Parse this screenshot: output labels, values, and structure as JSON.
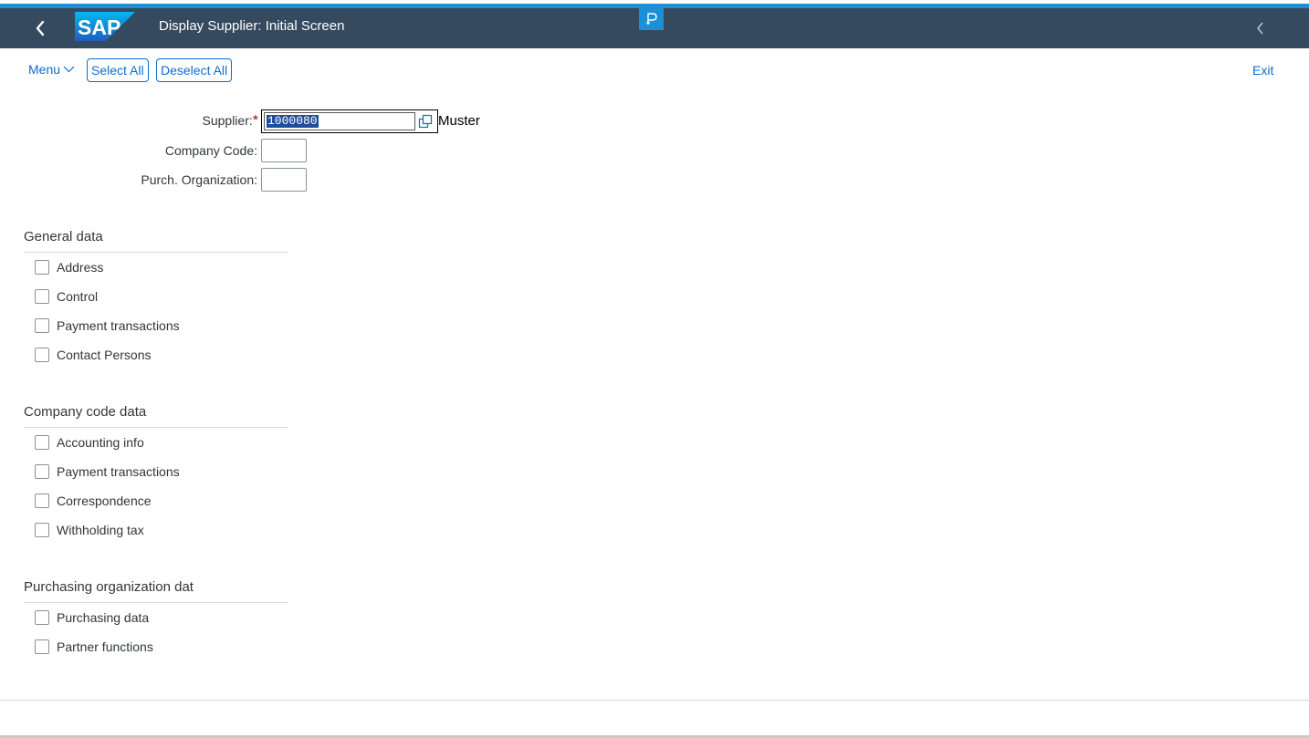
{
  "shell": {
    "title": "Display Supplier:  Initial Screen",
    "logo_text": "SAP",
    "brand_color": "#354a5f",
    "accent_color": "#1b90d8",
    "icons": [
      "back-icon",
      "sap-logo",
      "app-icon",
      "collapse-icon"
    ]
  },
  "toolbar": {
    "menu_label": "Menu",
    "select_all_label": "Select All",
    "deselect_all_label": "Deselect All",
    "exit_label": "Exit"
  },
  "fields": {
    "supplier_label": "Supplier:",
    "required_marker": "*",
    "supplier_value": "1000080",
    "supplier_name": "Muster",
    "company_code_label": "Company Code:",
    "company_code_value": "",
    "purch_org_label": "Purch. Organization:",
    "purch_org_value": ""
  },
  "sections": {
    "general": {
      "title": "General data",
      "items": [
        "Address",
        "Control",
        "Payment transactions",
        "Contact Persons"
      ]
    },
    "company": {
      "title": "Company code data",
      "items": [
        "Accounting info",
        "Payment transactions",
        "Correspondence",
        "Withholding tax"
      ]
    },
    "purchasing": {
      "title": "Purchasing organization dat",
      "items": [
        "Purchasing data",
        "Partner functions"
      ]
    }
  }
}
